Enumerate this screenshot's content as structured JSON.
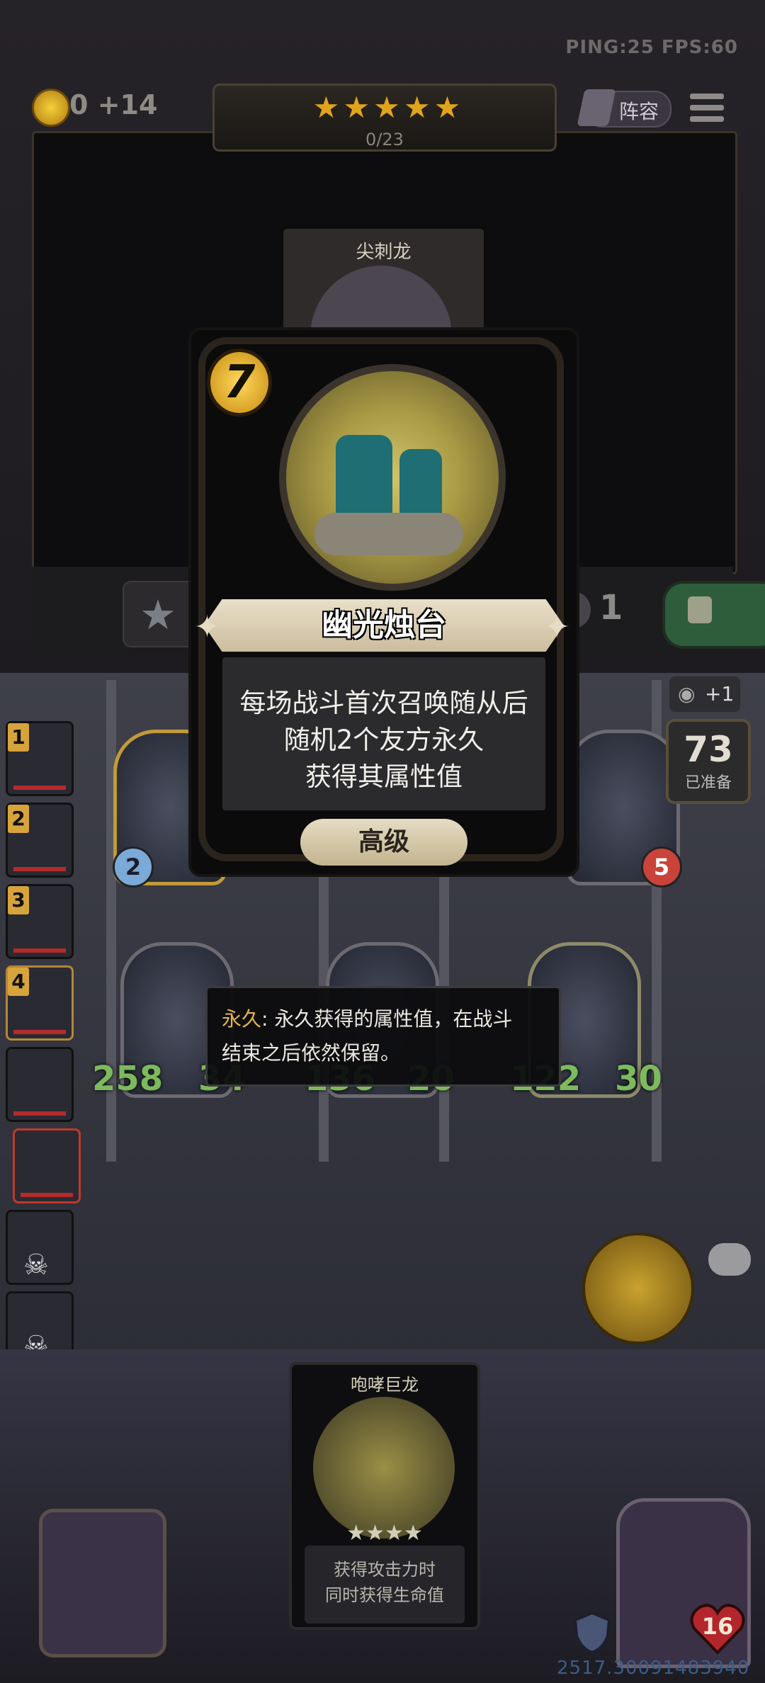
{
  "hud": {
    "gold": "0",
    "gold_income": "+14",
    "stars": [
      "★",
      "★",
      "★",
      "★",
      "★"
    ],
    "xp_progress": "0/23",
    "lineup_label": "阵容",
    "ping_fps": "PING:25  FPS:60",
    "shop_back_card_name": "尖刺龙",
    "cost_reroll": "1",
    "reroll_bonus": "+1",
    "ready_count": "73",
    "ready_label": "已准备"
  },
  "players": [
    {
      "rank": "1"
    },
    {
      "rank": "2"
    },
    {
      "rank": "3"
    },
    {
      "rank": "4"
    },
    {
      "rank": ""
    },
    {
      "rank": ""
    },
    {
      "rank": ""
    },
    {
      "rank": ""
    }
  ],
  "board": {
    "minions": [
      {
        "attack": "2",
        "health": "",
        "name": ""
      },
      {
        "attack": "",
        "health": "5",
        "name": ""
      },
      {
        "attack": "258",
        "health": "34"
      },
      {
        "attack": "136",
        "health": "20"
      },
      {
        "attack": "122",
        "health": "30"
      }
    ]
  },
  "card": {
    "cost": "7",
    "name": "幽光烛台",
    "description_lines": [
      "每场战斗首次召唤随从后",
      "随机2个友方永久",
      "获得其属性值"
    ],
    "tier": "高级"
  },
  "keyword_tip": {
    "keyword": "永久",
    "line1_rest": ": 永久获得的属性值，在战斗",
    "line2": "结束之后依然保留。"
  },
  "hand_card": {
    "name": "咆哮巨龙",
    "stars": "★★★★",
    "desc_line1": "获得攻击力时",
    "desc_line2": "同时获得生命值"
  },
  "hero": {
    "health": "16"
  },
  "footer": {
    "coords": "2517.30091483940"
  },
  "colors": {
    "gold": "#e0a41c",
    "stat_green": "#7cba5d",
    "card_banner": "#e9dfc8",
    "keyword": "#e6b54a",
    "lock_green": "#2e5d3b"
  }
}
